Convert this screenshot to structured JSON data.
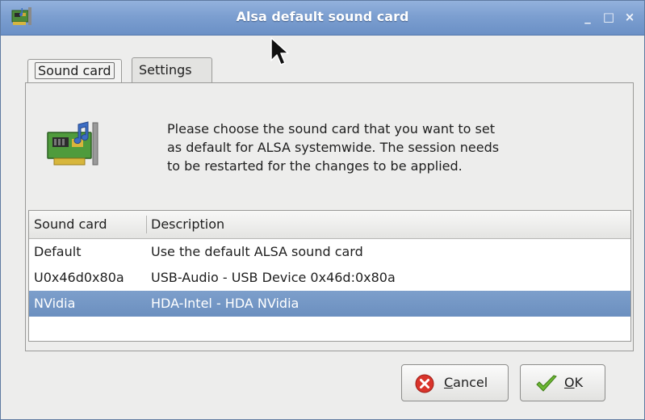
{
  "window": {
    "title": "Alsa default sound card",
    "controls": {
      "minimize": "_",
      "maximize": "□",
      "close": "×"
    },
    "app_icon": "sound-card-icon"
  },
  "tabs": [
    {
      "label": "Sound card",
      "active": true
    },
    {
      "label": "Settings",
      "active": false
    }
  ],
  "intro": {
    "icon": "sound-card-icon",
    "text_lines": [
      "Please choose the sound card that you want to set",
      "as default for ALSA systemwide. The session needs",
      "to be restarted for the changes to be applied."
    ]
  },
  "list": {
    "columns": [
      "Sound card",
      "Description"
    ],
    "rows": [
      {
        "card": "Default",
        "description": "Use the default ALSA sound card",
        "selected": false
      },
      {
        "card": "U0x46d0x80a",
        "description": "USB-Audio - USB Device 0x46d:0x80a",
        "selected": false
      },
      {
        "card": "NVidia",
        "description": "HDA-Intel - HDA NVidia",
        "selected": true
      }
    ]
  },
  "buttons": {
    "cancel": {
      "label": "Cancel",
      "icon": "cancel-icon"
    },
    "ok": {
      "label": "OK",
      "icon": "checkmark-icon"
    }
  },
  "colors": {
    "titlebar": "#7c9fd0",
    "selection": "#7394c4",
    "cancel_red": "#d9342b",
    "ok_green": "#6cb733"
  }
}
